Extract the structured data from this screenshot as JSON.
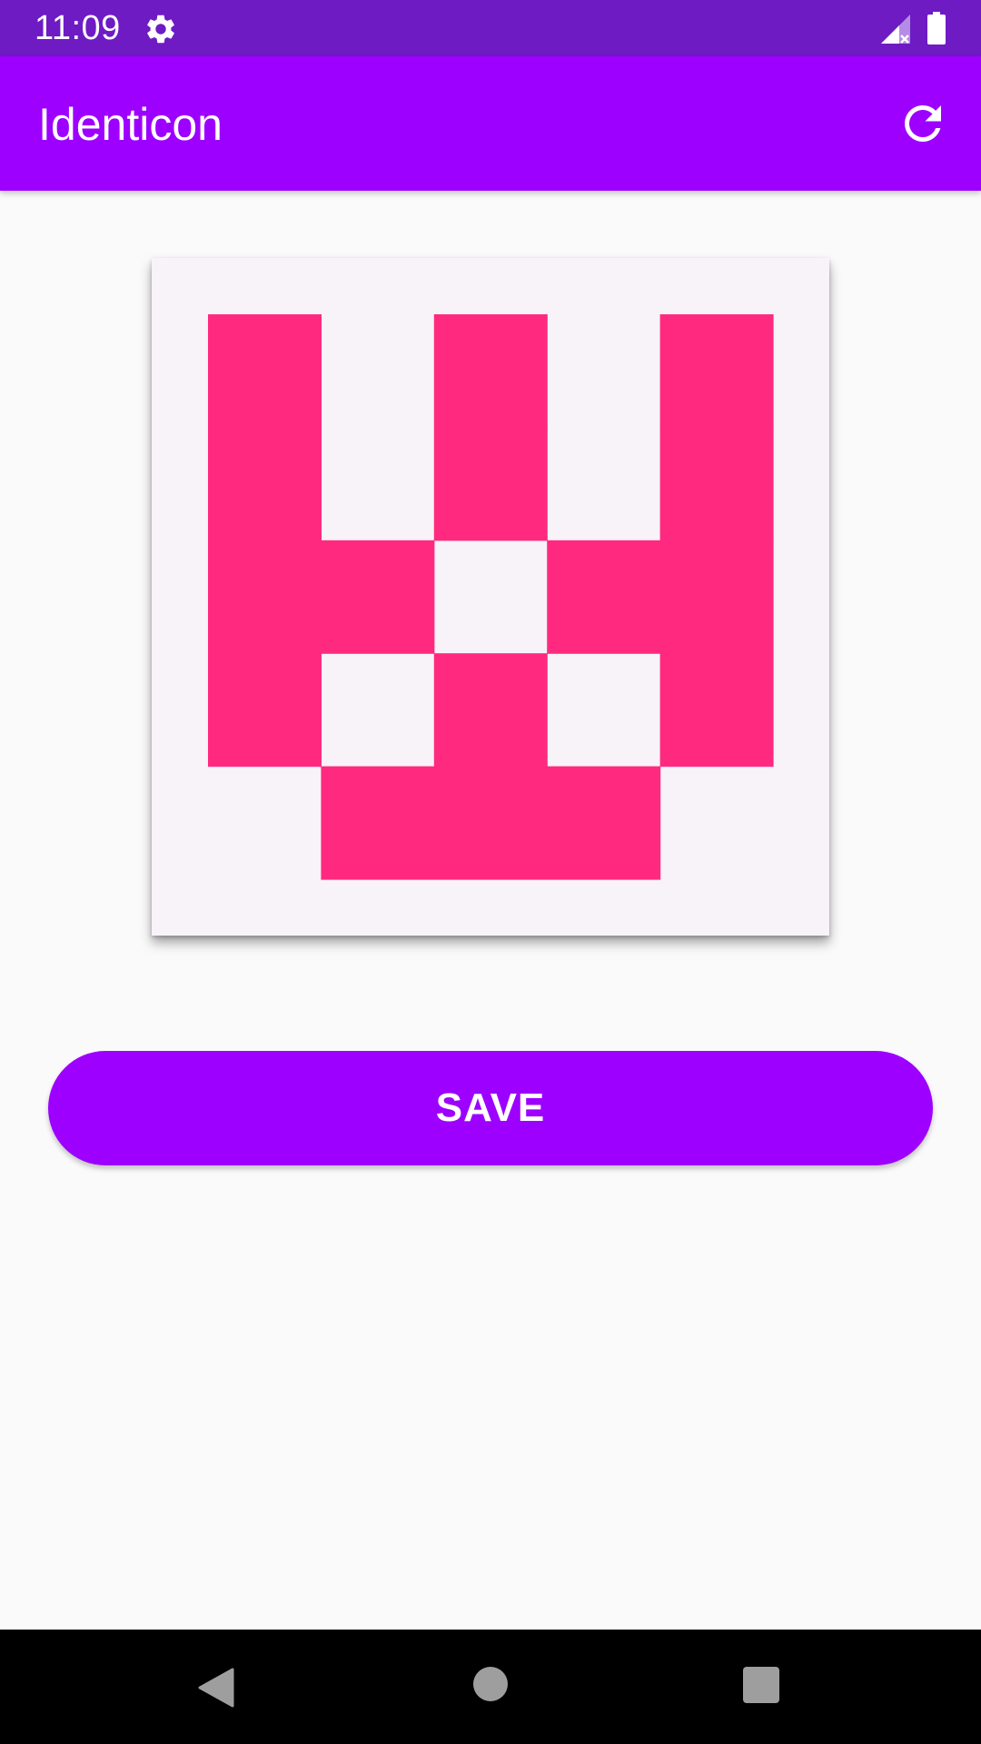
{
  "status_bar": {
    "time": "11:09",
    "icons": [
      "gear-icon",
      "signal-icon",
      "battery-icon"
    ]
  },
  "app_bar": {
    "title": "Identicon",
    "action_icon": "refresh-icon"
  },
  "identicon": {
    "foreground": "#ff2a7f",
    "background": "#f8f3f8",
    "grid": [
      [
        1,
        0,
        1,
        0,
        1
      ],
      [
        1,
        0,
        1,
        0,
        1
      ],
      [
        1,
        1,
        0,
        1,
        1
      ],
      [
        1,
        0,
        1,
        0,
        1
      ],
      [
        0,
        1,
        1,
        1,
        0
      ]
    ]
  },
  "actions": {
    "save_label": "SAVE"
  },
  "nav_bar": {
    "icons": [
      "back-icon",
      "home-icon",
      "recents-icon"
    ]
  },
  "colors": {
    "status_bar": "#6e1bc4",
    "primary": "#9d00ff",
    "surface": "#fafafa",
    "nav_bar": "#000000"
  }
}
